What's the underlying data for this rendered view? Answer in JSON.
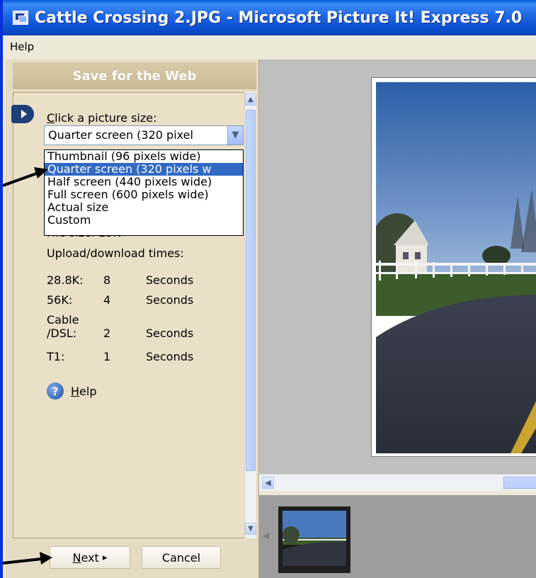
{
  "window": {
    "title": "Cattle Crossing 2.JPG - Microsoft Picture It! Express 7.0"
  },
  "menu": {
    "items": [
      "Help"
    ]
  },
  "panel": {
    "header": "Save for the Web",
    "step_label_accel": "C",
    "step_label_rest": "lick a picture size:",
    "combo_value": "Quarter screen (320 pixel",
    "dropdown_options": [
      {
        "label": "Thumbnail (96 pixels wide)",
        "selected": false
      },
      {
        "label": "Quarter screen (320 pixels w",
        "selected": true
      },
      {
        "label": "Half screen (440 pixels wide)",
        "selected": false
      },
      {
        "label": "Full screen (600 pixels wide)",
        "selected": false
      },
      {
        "label": "Actual size",
        "selected": false
      },
      {
        "label": "Custom",
        "selected": false
      }
    ],
    "file_size_partial": "File size:  25K",
    "upload_label": "Upload/download times:",
    "speeds": [
      {
        "name": "28.8K:",
        "value": "8",
        "unit": "Seconds"
      },
      {
        "name": "56K:",
        "value": "4",
        "unit": "Seconds"
      },
      {
        "name": "Cable",
        "name2": "/DSL:",
        "value": "2",
        "unit": "Seconds"
      },
      {
        "name": "T1:",
        "value": "1",
        "unit": "Seconds"
      }
    ],
    "help_accel": "H",
    "help_rest": "elp",
    "next_accel": "N",
    "next_rest": "ext",
    "next_arrow": "▸",
    "cancel_label": "Cancel"
  },
  "colors": {
    "selection": "#316ac5",
    "titlebar": "#0a5fdc",
    "panel_bg": "#e6dcc3"
  }
}
